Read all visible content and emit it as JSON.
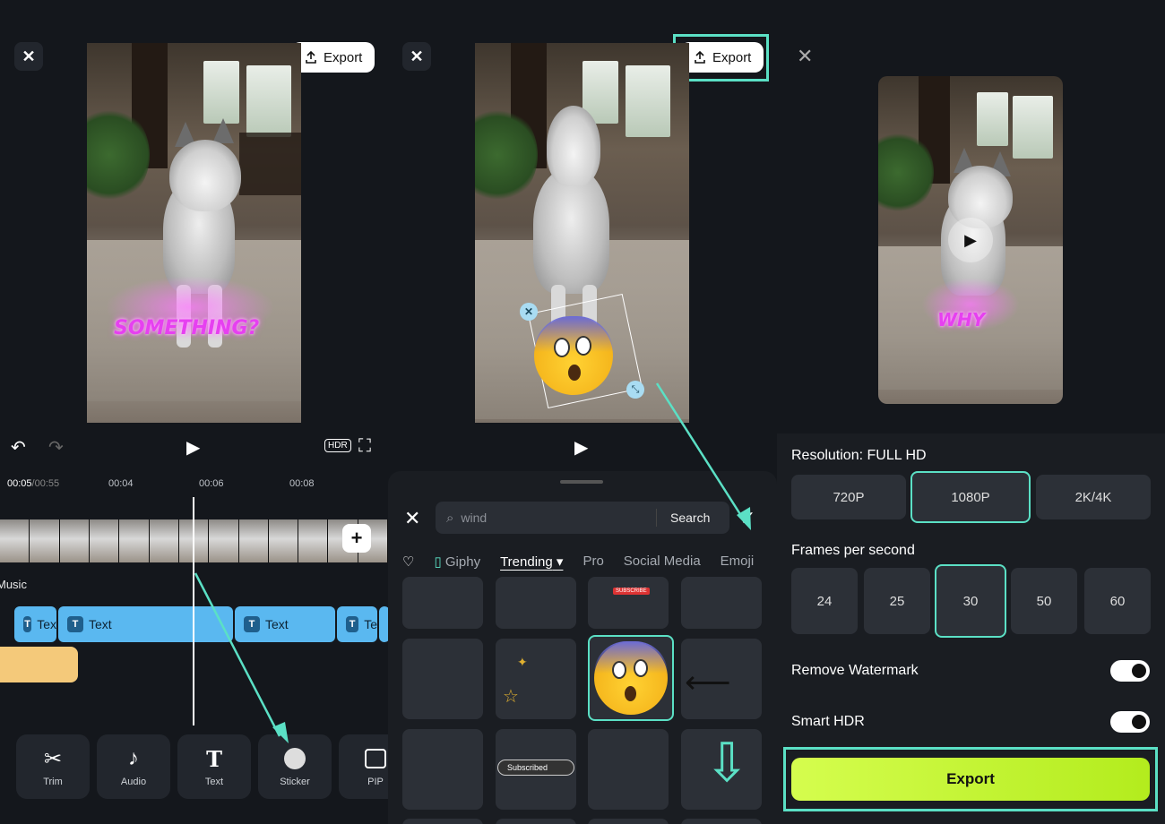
{
  "colors": {
    "accent": "#5be0c5",
    "export_green": "#c8f43a",
    "text_clip": "#5ab8f0",
    "audio_clip": "#f4c97a",
    "caption_pink": "#e640f0"
  },
  "editor": {
    "close_icon": "close-icon",
    "export_label": "Export",
    "caption": "SOMETHING?",
    "timecode_current": "00:05",
    "timecode_total": "/00:55",
    "ruler": [
      "00:04",
      "00:06",
      "00:08"
    ],
    "track_music": "Music",
    "text_clips": [
      "Tex",
      "Text",
      "Text",
      "Te"
    ],
    "tools": [
      {
        "label": "Trim",
        "icon": "scissors-icon"
      },
      {
        "label": "Audio",
        "icon": "music-note-icon"
      },
      {
        "label": "Text",
        "icon": "text-icon"
      },
      {
        "label": "Sticker",
        "icon": "sticker-icon"
      },
      {
        "label": "PIP",
        "icon": "pip-icon"
      }
    ]
  },
  "sticker_picker": {
    "export_label": "Export",
    "search_value": "wind",
    "search_placeholder": "wind",
    "search_button": "Search",
    "tabs": [
      "Giphy",
      "Trending",
      "Pro",
      "Social Media",
      "Emoji"
    ],
    "active_tab": "Trending",
    "sticker_subscribe_small": "SUBSCRIBE",
    "sticker_subscribed": "Subscribed"
  },
  "export_dialog": {
    "caption": "WHY",
    "resolution_title": "Resolution: FULL HD",
    "resolutions": [
      "720P",
      "1080P",
      "2K/4K"
    ],
    "resolution_selected": "1080P",
    "fps_title": "Frames per second",
    "fps_options": [
      "24",
      "25",
      "30",
      "50",
      "60"
    ],
    "fps_selected": "30",
    "remove_watermark_label": "Remove Watermark",
    "remove_watermark_on": true,
    "smart_hdr_label": "Smart HDR",
    "smart_hdr_on": true,
    "export_button": "Export"
  }
}
